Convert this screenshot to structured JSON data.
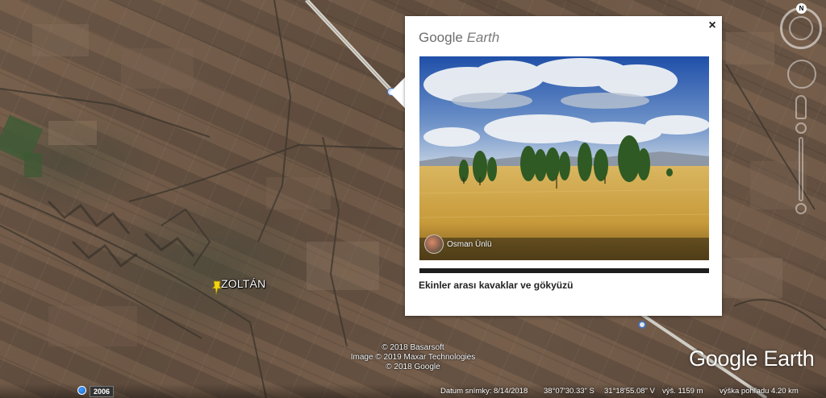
{
  "placemark": {
    "label": "ZOLTÁN",
    "icon": "yellow-pushpin-icon",
    "color": "#f5d40f"
  },
  "balloon": {
    "brand_google": "Google",
    "brand_earth": "Earth",
    "close_symbol": "×",
    "photo_author": "Osman Ünlü",
    "caption": "Ekinler arası kavaklar ve gökyüzü"
  },
  "attribution": {
    "line1": "© 2018 Basarsoft",
    "line2": "Image © 2019 Maxar Technologies",
    "line3": "© 2018 Google"
  },
  "logo": "Google Earth",
  "navigation": {
    "north_label": "N"
  },
  "status_bar": {
    "year_badge": "2006",
    "imagery_date": "Datum snímky: 8/14/2018",
    "latitude": "38°07'30.33\" S",
    "longitude": "31°18'55.08\" V",
    "elevation": "výš.  1159 m",
    "eye_alt": "výška pohľadu    4.20 km"
  },
  "colors": {
    "balloon_bg": "#ffffff",
    "pin": "#f5d40f",
    "poi": "#4a6fb0"
  }
}
